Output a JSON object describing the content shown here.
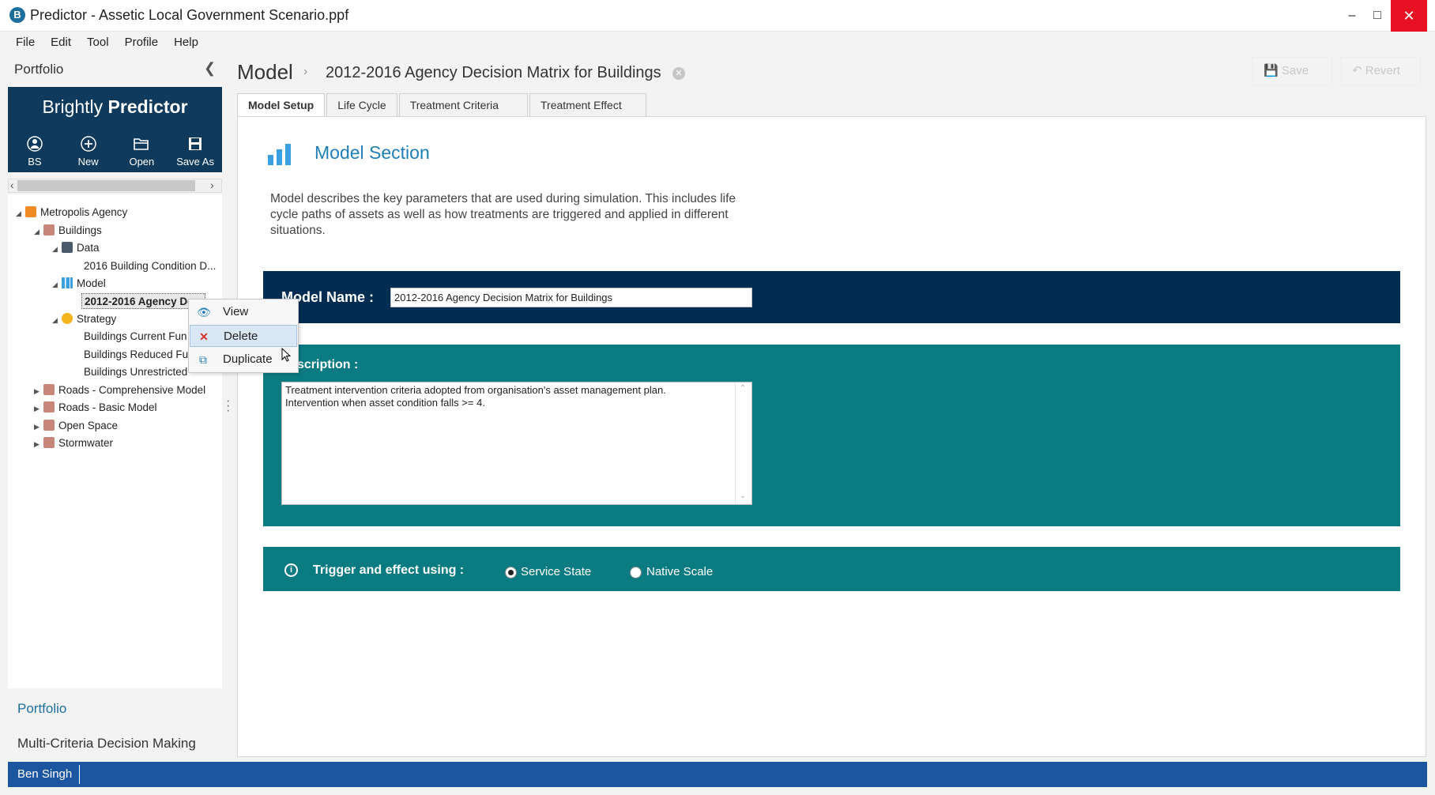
{
  "window": {
    "title": "Predictor - Assetic Local Government Scenario.ppf",
    "minimize": "–",
    "maximize": "□",
    "close": "✕"
  },
  "menu": [
    "File",
    "Edit",
    "Tool",
    "Profile",
    "Help"
  ],
  "sidebar": {
    "header": "Portfolio",
    "brand_light": "Brightly ",
    "brand_bold": "Predictor",
    "toolbar": [
      {
        "label": "BS",
        "icon": "user-icon"
      },
      {
        "label": "New",
        "icon": "plus-circle-icon"
      },
      {
        "label": "Open",
        "icon": "folder-open-icon"
      },
      {
        "label": "Save As",
        "icon": "save-icon"
      }
    ],
    "tree": [
      {
        "label": "Metropolis Agency",
        "icon": "agency-icon",
        "level": 0,
        "expanded": true
      },
      {
        "label": "Buildings",
        "icon": "folder-icon",
        "level": 1,
        "expanded": true
      },
      {
        "label": "Data",
        "icon": "data-icon",
        "level": 2,
        "expanded": true
      },
      {
        "label": "2016 Building Condition D...",
        "level": 3
      },
      {
        "label": "Model",
        "icon": "model-icon",
        "level": 2,
        "expanded": true
      },
      {
        "label": "2012-2016 Agency De...",
        "level": 3,
        "selected": true
      },
      {
        "label": "Strategy",
        "icon": "strategy-icon",
        "level": 2,
        "expanded": true
      },
      {
        "label": "Buildings Current Fun",
        "level": 3
      },
      {
        "label": "Buildings Reduced Fur",
        "level": 3
      },
      {
        "label": "Buildings Unrestricted",
        "level": 3
      },
      {
        "label": "Roads - Comprehensive Model",
        "icon": "folder-icon",
        "level": 1,
        "expanded": false
      },
      {
        "label": "Roads - Basic Model",
        "icon": "folder-icon",
        "level": 1,
        "expanded": false
      },
      {
        "label": "Open Space",
        "icon": "folder-icon",
        "level": 1,
        "expanded": false
      },
      {
        "label": "Stormwater",
        "icon": "folder-icon",
        "level": 1,
        "expanded": false
      }
    ],
    "nav": {
      "portfolio": "Portfolio",
      "mcdm": "Multi-Criteria Decision Making"
    }
  },
  "context_menu": [
    {
      "label": "View",
      "icon": "eye-icon"
    },
    {
      "label": "Delete",
      "icon": "delete-x-icon",
      "hover": true
    },
    {
      "label": "Duplicate",
      "icon": "duplicate-icon"
    }
  ],
  "main": {
    "breadcrumb_root": "Model",
    "breadcrumb_name": "2012-2016 Agency Decision Matrix for Buildings",
    "save_label": "Save",
    "revert_label": "Revert",
    "tabs": [
      {
        "label": "Model Setup",
        "active": true
      },
      {
        "label": "Life Cycle"
      },
      {
        "label": "Treatment Criteria"
      },
      {
        "label": "Treatment Effect"
      }
    ],
    "section_title": "Model Section",
    "section_desc": "Model describes the key parameters that are used during simulation. This includes life cycle paths of assets as well as how treatments are triggered and applied in different situations.",
    "model_name_label": "Model Name :",
    "model_name_value": "2012-2016 Agency Decision Matrix for Buildings",
    "description_label": "scription :",
    "description_value": "Treatment intervention criteria adopted from organisation's asset management plan.\nIntervention when asset condition falls >= 4.",
    "trigger_label": "Trigger and effect using :",
    "trigger_options": [
      {
        "label": "Service State",
        "selected": true
      },
      {
        "label": "Native Scale",
        "selected": false
      }
    ]
  },
  "status": {
    "user": "Ben Singh"
  },
  "colors": {
    "brand_navy": "#0f3a5c",
    "name_band": "#022d52",
    "teal_band": "#0b7b82",
    "status_bar": "#1c56a0",
    "accent_blue": "#1e7fb8"
  }
}
